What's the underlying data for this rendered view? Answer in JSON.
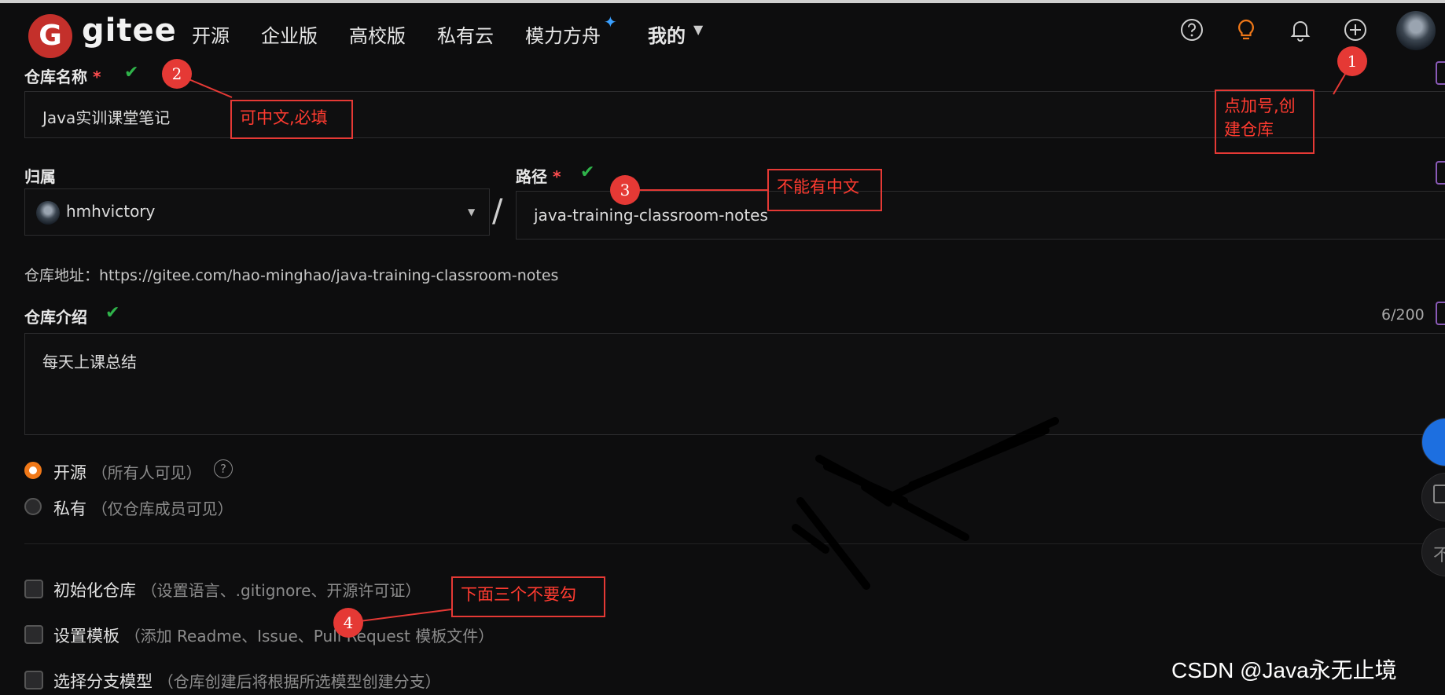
{
  "nav": {
    "logo_text": "gitee",
    "logo_letter": "G",
    "items": [
      "开源",
      "企业版",
      "高校版",
      "私有云",
      "模力方舟"
    ],
    "sparkle": "✦",
    "mine": "我的"
  },
  "form": {
    "repo_name": {
      "label": "仓库名称",
      "required": "*",
      "check": "✔",
      "value": "Java实训课堂笔记"
    },
    "owner": {
      "label": "归属",
      "value": "hmhvictory",
      "separator": "/"
    },
    "path": {
      "label": "路径",
      "required": "*",
      "check": "✔",
      "value": "java-training-classroom-notes"
    },
    "repo_address": {
      "label": "仓库地址：",
      "value": "https://gitee.com/hao-minghao/java-training-classroom-notes"
    },
    "intro": {
      "label": "仓库介绍",
      "check": "✔",
      "counter": "6/200",
      "value": "每天上课总结"
    },
    "visibility": [
      {
        "label": "开源",
        "hint": "（所有人可见）",
        "help": "?",
        "selected": true
      },
      {
        "label": "私有",
        "hint": "（仅仓库成员可见）",
        "selected": false
      }
    ],
    "options": [
      {
        "label": "初始化仓库",
        "hint": "（设置语言、.gitignore、开源许可证）"
      },
      {
        "label": "设置模板",
        "hint": "（添加 Readme、Issue、Pull Request 模板文件）"
      },
      {
        "label": "选择分支模型",
        "hint": "（仓库创建后将根据所选模型创建分支）"
      }
    ]
  },
  "annotations": [
    {
      "number": "1",
      "text": "点加号,创\n建仓库"
    },
    {
      "number": "2",
      "text": "可中文,必填"
    },
    {
      "number": "3",
      "text": "不能有中文"
    },
    {
      "number": "4",
      "text": "下面三个不要勾"
    }
  ],
  "side_buttons": {
    "third_glyph": "不"
  },
  "watermark": "CSDN @Java永无止境",
  "colors": {
    "accent_orange": "#f07818",
    "annotation_red": "#e53935",
    "check_green": "#2fb34a",
    "logo_red": "#c4302b"
  }
}
